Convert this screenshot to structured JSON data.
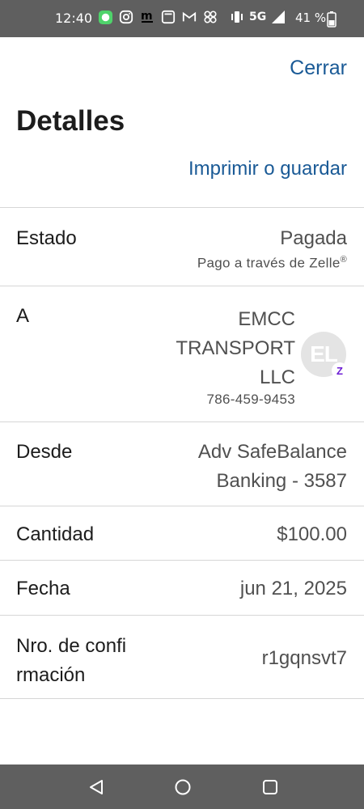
{
  "status_bar": {
    "time": "12:40",
    "network": "5G",
    "battery_percent": "41 %",
    "icons": [
      "whatsapp-icon",
      "instagram-icon",
      "m-zone-icon",
      "screenshot-icon",
      "gmail-icon",
      "pinwheel-icon",
      "vibrate-icon",
      "signal-icon",
      "battery-icon"
    ]
  },
  "header": {
    "close_label": "Cerrar",
    "title": "Detalles",
    "print_label": "Imprimir o guardar"
  },
  "details": {
    "status": {
      "label": "Estado",
      "value": "Pagada",
      "sub": "Pago a través de Zelle",
      "sub_mark": "®"
    },
    "recipient": {
      "label": "A",
      "name_lines": [
        "EMCC",
        "TRANSPORT",
        "LLC"
      ],
      "phone": "786-459-9453",
      "avatar_initials": "EL",
      "badge": "Z"
    },
    "from": {
      "label": "Desde",
      "value_lines": [
        "Adv SafeBalance",
        "Banking - 3587"
      ]
    },
    "amount": {
      "label": "Cantidad",
      "value": "$100.00"
    },
    "date": {
      "label": "Fecha",
      "value": "jun 21, 2025"
    },
    "confirmation": {
      "label_lines": [
        "Nro. de confi",
        "rmación"
      ],
      "value": "r1gqnsvt7"
    }
  },
  "colors": {
    "link": "#1a5a96",
    "system_bars": "#5f5f5f",
    "zelle_purple": "#6d1ed4"
  }
}
